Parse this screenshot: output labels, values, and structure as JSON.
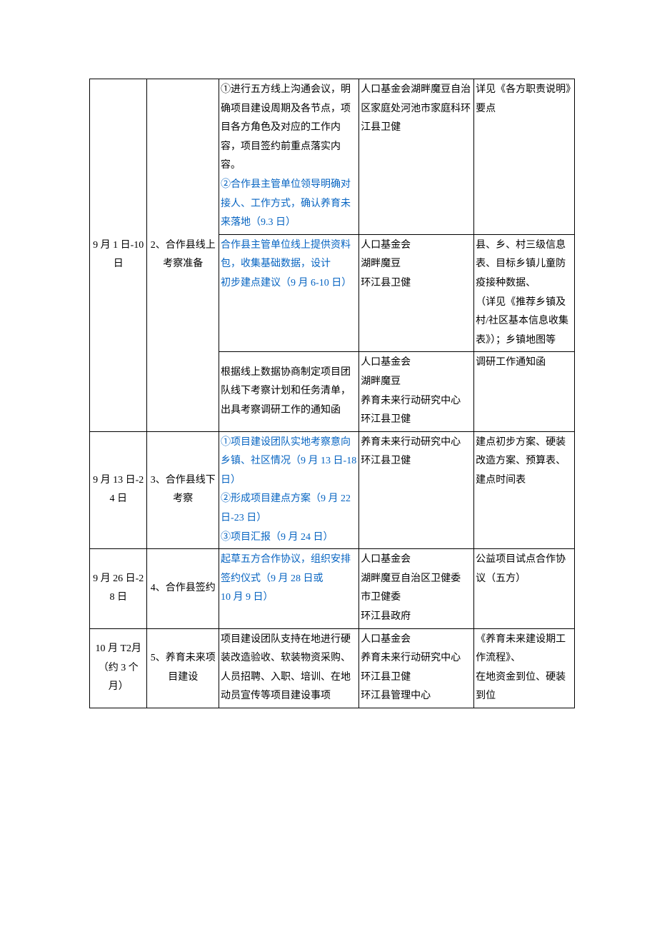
{
  "rows": [
    {
      "date": "9 月 1 日-10 日",
      "task": "2、合作县线上考察准备",
      "sub": [
        {
          "content_html": "①进行五方线上沟通会议，明确项目建设周期及各节点，项目各方角色及对应的工作内容，项目签约前重点落实内容。<br><span class='blue'>②合作县主管单位领导明确对接人、工作方式，确认养育未来落地（9.3 日）</span>",
          "resp": "人口基金会湖畔魔豆自治区家庭处河池市家庭科环江县卫健",
          "note": "详见《各方职责说明》要点"
        },
        {
          "content_html": "<span class='blue'>合作县主管单位线上提供资料包，收集基础数据，设计<br>初步建点建议（9 月 6-10 日）</span>",
          "resp": "人口基金会<br>湖畔魔豆<br>环江县卫健",
          "note": "县、乡、村三级信息表、目标乡镇儿童防疫接种数据、<br><span class='indent'>（详见《推荐乡镇</span>及村/社区基本信息收集表》）；乡镇地图等"
        },
        {
          "content_html": "根据线上数据协商制定项目团队线下考察计划和任务清单，出具考察调研工作的通知函",
          "resp": "人口基金会<br>湖畔魔豆<br>养育未来行动研究中心<br>环江县卫健",
          "note": "调研工作通知函"
        }
      ]
    },
    {
      "date": "9 月 13 日-24 日",
      "task": "3、合作县线下考察",
      "content_html": "<span class='blue'>①项目建设团队实地考察意向乡镇、社区情况（9 月 13 日-18 日）<br>②形成项目建点方案（9 月 22 日-23 日）<br>③项目汇报（9 月 24 日）</span>",
      "resp": "养育未来行动研究中心<br>环江县卫健",
      "note": "建点初步方案、硬装改造方案、预算表、建点时间表"
    },
    {
      "date": "9 月 26 日-28 日",
      "task": "4、合作县签约",
      "content_html": "<span class='blue'>起草五方合作协议，组织安排签约仪式（9 月 28 日或<br>10 月 9 日）</span>",
      "resp": "人口基金会<br>湖畔魔豆自治区卫健委<br>市卫健委<br>环江县政府",
      "note": "公益项目试点合作协议（五方）"
    },
    {
      "date": "10 月 T2月（约 3 个月）",
      "task": "5、养育未来项目建设",
      "content_html": "项目建设团队支持在地进行硬装改造验收、软装物资采购、人员招聘、入职、培训、在地动员宣传等项目建设事项",
      "resp": "人口基金会<br>养育未来行动研究中心<br>环江县卫健<br>环江县管理中心",
      "note": "<span class='indent'>《养育未来建设期</span>工作流程》、<br>在地资金到位、硬装到位"
    }
  ]
}
